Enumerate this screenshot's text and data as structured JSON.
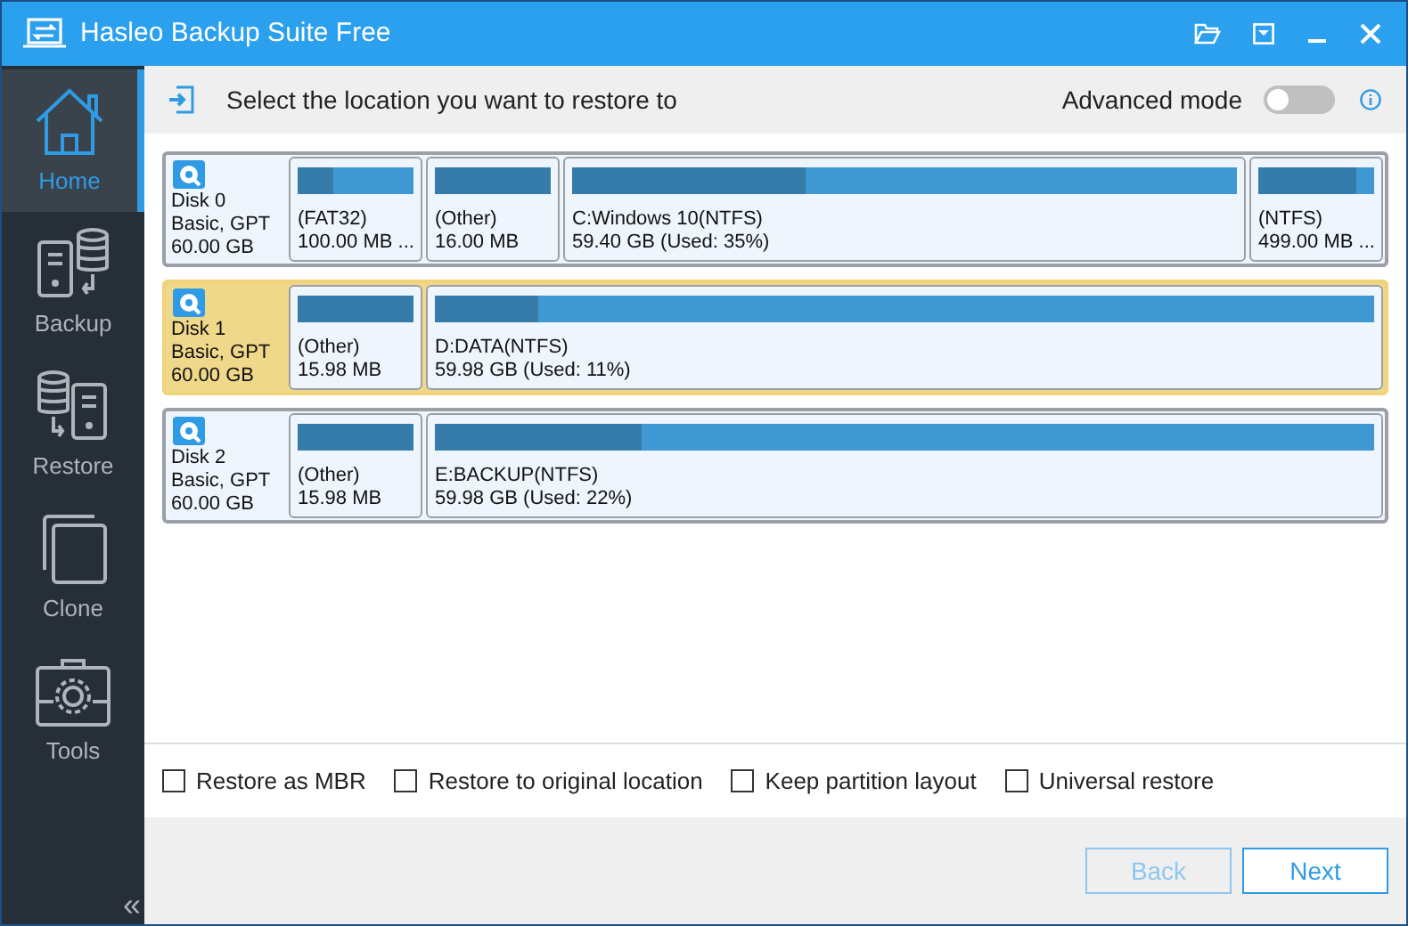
{
  "window": {
    "title": "Hasleo Backup Suite Free"
  },
  "sidebar": {
    "items": [
      {
        "label": "Home",
        "selected": true,
        "kind": "home"
      },
      {
        "label": "Backup",
        "selected": false,
        "kind": "backup"
      },
      {
        "label": "Restore",
        "selected": false,
        "kind": "restore"
      },
      {
        "label": "Clone",
        "selected": false,
        "kind": "clone"
      },
      {
        "label": "Tools",
        "selected": false,
        "kind": "tools"
      }
    ],
    "collapse": "«"
  },
  "header": {
    "instruction": "Select the location you want to restore to",
    "advanced_mode": {
      "label": "Advanced mode",
      "on": false
    }
  },
  "disks": [
    {
      "name": "Disk 0",
      "type": "Basic, GPT",
      "size": "60.00 GB",
      "selected": false,
      "partitions": [
        {
          "kind": "small",
          "label": "(FAT32)",
          "detail": "100.00 MB ...",
          "level": 0.3
        },
        {
          "kind": "small",
          "label": "(Other)",
          "detail": "16.00 MB",
          "level": 1
        },
        {
          "kind": "large",
          "label": "C:Windows 10(NTFS)",
          "detail": "59.40 GB (Used: 35%)",
          "level": 0.35
        },
        {
          "kind": "small",
          "label": "(NTFS)",
          "detail": "499.00 MB ...",
          "level": 0.85
        }
      ]
    },
    {
      "name": "Disk 1",
      "type": "Basic, GPT",
      "size": "60.00 GB",
      "selected": true,
      "partitions": [
        {
          "kind": "small",
          "label": "(Other)",
          "detail": "15.98 MB",
          "level": 1
        },
        {
          "kind": "large",
          "label": "D:DATA(NTFS)",
          "detail": "59.98 GB (Used: 11%)",
          "level": 0.11
        }
      ]
    },
    {
      "name": "Disk 2",
      "type": "Basic, GPT",
      "size": "60.00 GB",
      "selected": false,
      "partitions": [
        {
          "kind": "small",
          "label": "(Other)",
          "detail": "15.98 MB",
          "level": 1
        },
        {
          "kind": "large",
          "label": "E:BACKUP(NTFS)",
          "detail": "59.98 GB (Used: 22%)",
          "level": 0.22
        }
      ]
    }
  ],
  "options": [
    {
      "label": "Restore as MBR",
      "checked": false
    },
    {
      "label": "Restore to original location",
      "checked": false
    },
    {
      "label": "Keep partition layout",
      "checked": false
    },
    {
      "label": "Universal restore",
      "checked": false
    }
  ],
  "buttons": [
    {
      "label": "Back",
      "disabled": true
    },
    {
      "label": "Next",
      "disabled": false
    }
  ]
}
